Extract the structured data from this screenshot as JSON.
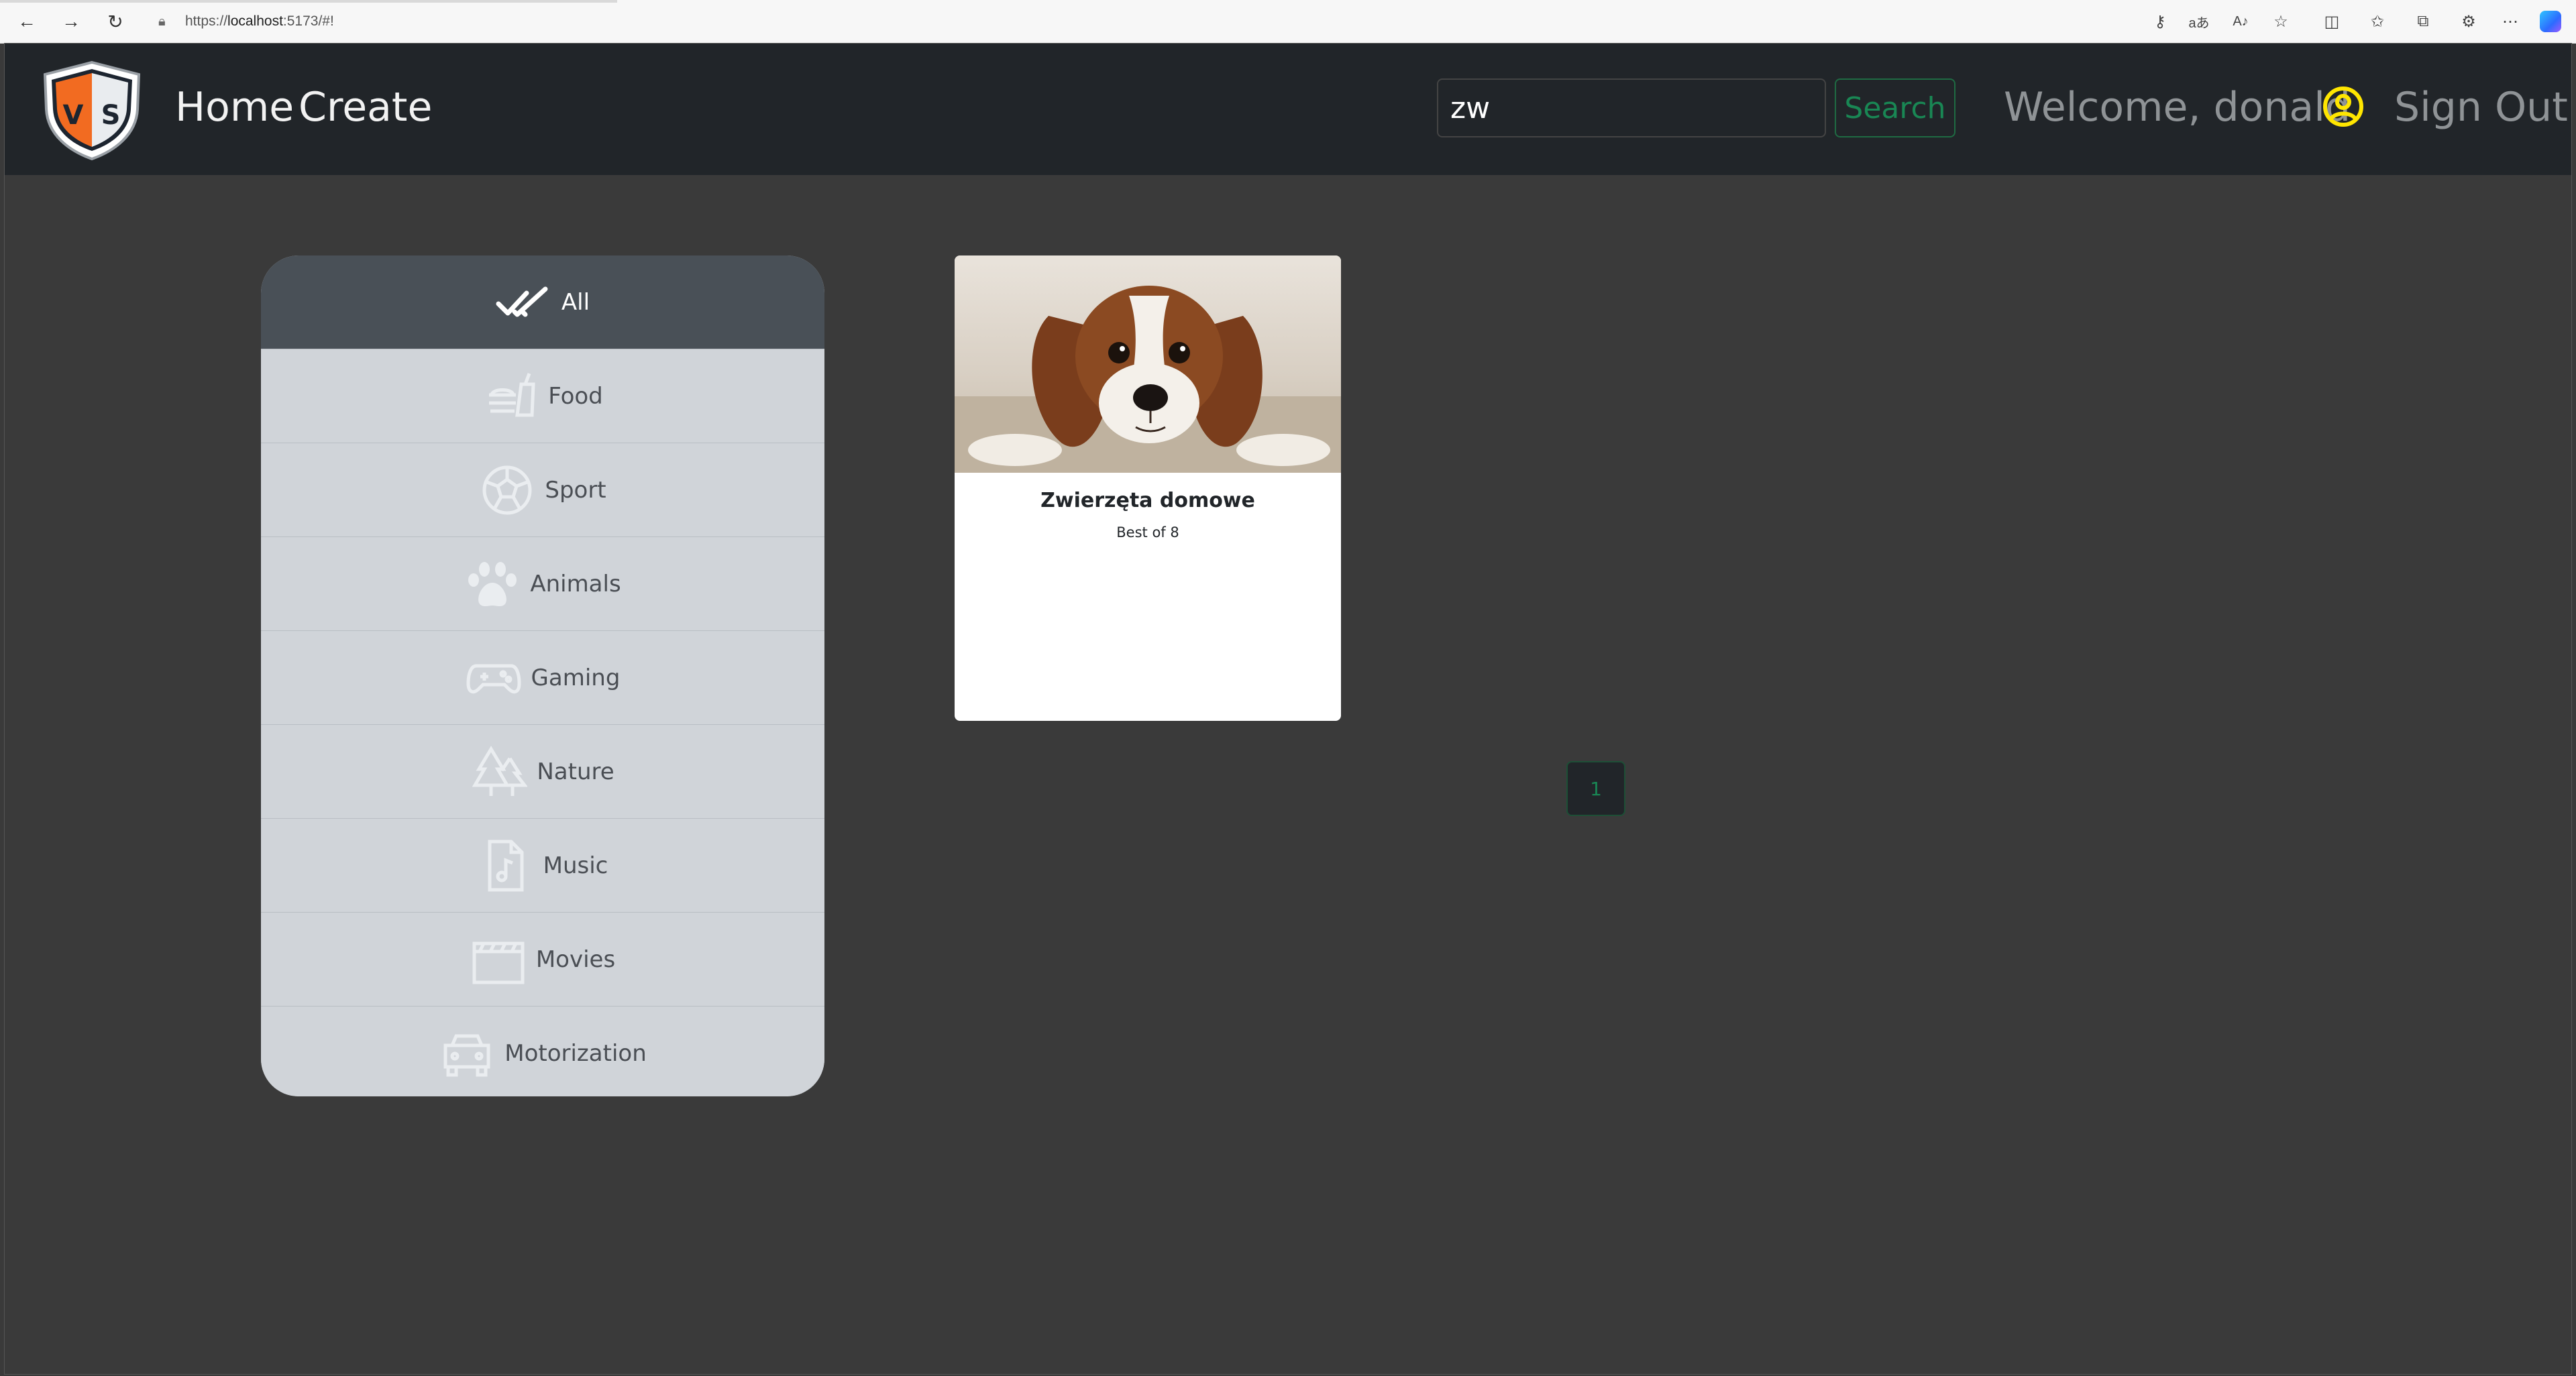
{
  "browser": {
    "url_prefix": "https://",
    "url_host": "localhost",
    "url_rest": ":5173/#!",
    "icons": [
      "back-icon",
      "forward-icon",
      "refresh-icon",
      "lock-icon",
      "key-icon",
      "translate-icon",
      "read-aloud-icon",
      "favorite-icon",
      "split-screen-icon",
      "favorites-list-icon",
      "collections-icon",
      "extensions-icon",
      "more-icon",
      "copilot-icon"
    ]
  },
  "navbar": {
    "home_label": "Home",
    "create_label": "Create",
    "search_value": "zw",
    "search_button": "Search",
    "welcome_text": "Welcome, donald",
    "signout_label": "Sign Out",
    "logo_letters": [
      "V",
      "S"
    ],
    "colors": {
      "bg": "#212529",
      "search_accent": "#198754",
      "user_icon": "#ffe600"
    }
  },
  "categories": [
    {
      "label": "All",
      "icon": "double-check-icon",
      "active": true
    },
    {
      "label": "Food",
      "icon": "food-icon",
      "active": false
    },
    {
      "label": "Sport",
      "icon": "soccer-ball-icon",
      "active": false
    },
    {
      "label": "Animals",
      "icon": "paw-icon",
      "active": false
    },
    {
      "label": "Gaming",
      "icon": "gamepad-icon",
      "active": false
    },
    {
      "label": "Nature",
      "icon": "trees-icon",
      "active": false
    },
    {
      "label": "Music",
      "icon": "music-file-icon",
      "active": false
    },
    {
      "label": "Movies",
      "icon": "clapperboard-icon",
      "active": false
    },
    {
      "label": "Motorization",
      "icon": "car-icon",
      "active": false
    }
  ],
  "results": [
    {
      "title": "Zwierzęta domowe",
      "subtitle": "Best of 8",
      "image": "dog-photo"
    }
  ],
  "pagination": {
    "current_page": "1"
  }
}
